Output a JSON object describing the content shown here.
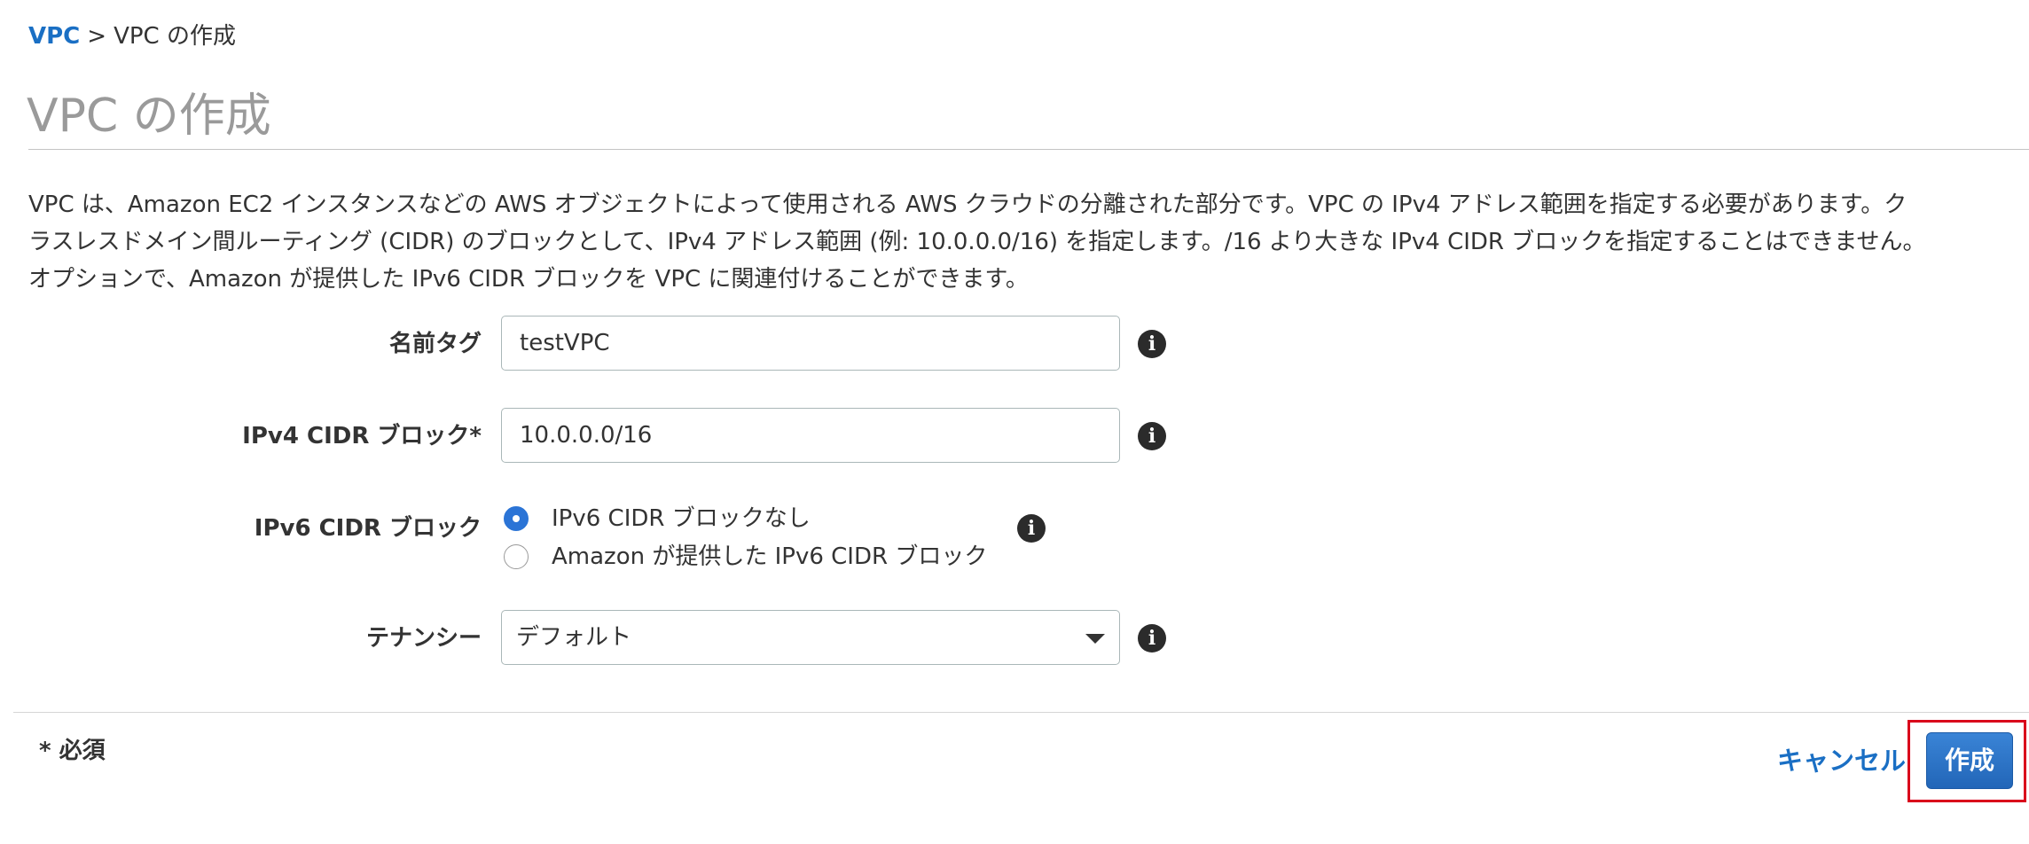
{
  "breadcrumb": {
    "root": "VPC",
    "separator": ">",
    "current": "VPC の作成"
  },
  "page_title": "VPC の作成",
  "description": {
    "lines": [
      "VPC は、Amazon EC2 インスタンスなどの AWS オブジェクトによって使用される AWS クラウドの分離された部分です。VPC の IPv4 アドレス範囲を指定する必要があります。ク",
      "ラスレスドメイン間ルーティング (CIDR) のブロックとして、IPv4 アドレス範囲 (例: 10.0.0.0/16) を指定します。/16 より大きな IPv4 CIDR ブロックを指定することはできません。",
      "オプションで、Amazon が提供した IPv6 CIDR ブロックを VPC に関連付けることができます。"
    ]
  },
  "form": {
    "name_tag": {
      "label": "名前タグ",
      "value": "testVPC"
    },
    "ipv4_cidr": {
      "label": "IPv4 CIDR ブロック*",
      "value": "10.0.0.0/16"
    },
    "ipv6_cidr": {
      "label": "IPv6 CIDR ブロック",
      "options": [
        {
          "label": "IPv6 CIDR ブロックなし",
          "selected": true
        },
        {
          "label": "Amazon が提供した IPv6 CIDR ブロック",
          "selected": false
        }
      ]
    },
    "tenancy": {
      "label": "テナンシー",
      "selected": "デフォルト"
    }
  },
  "footer": {
    "required_note": "* 必須",
    "cancel_label": "キャンセル",
    "create_label": "作成"
  },
  "icons": {
    "info": "info-icon",
    "dropdown": "chevron-down-icon",
    "radio_checked": "radio-checked",
    "radio_unchecked": "radio-unchecked"
  },
  "colors": {
    "link": "#1a6fc4",
    "title": "#9a9a9a",
    "button": "#2266b8",
    "radio_selected": "#2b74d6",
    "highlight": "#d9001b"
  }
}
